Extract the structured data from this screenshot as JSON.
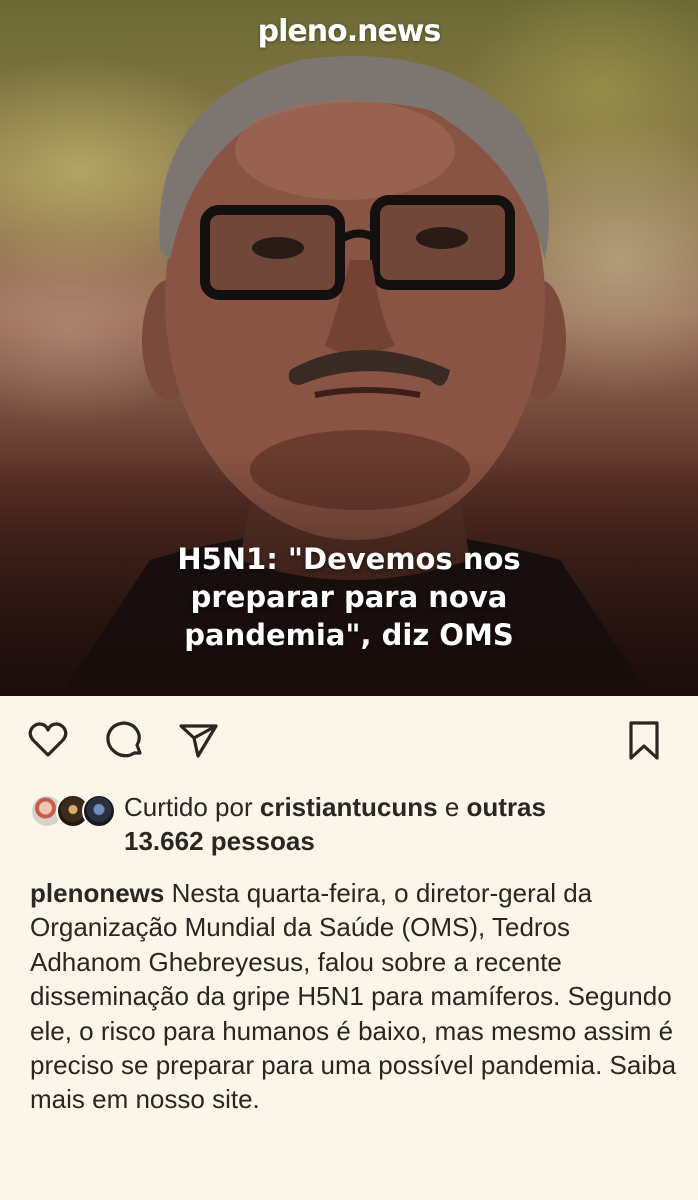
{
  "post": {
    "brand": "pleno.news",
    "headline_lines": [
      "H5N1: \"Devemos nos",
      "preparar para nova",
      "pandemia\", diz OMS"
    ]
  },
  "actions": {
    "icons": [
      "heart-icon",
      "comment-icon",
      "share-icon",
      "bookmark-icon"
    ]
  },
  "likes": {
    "prefix": "Curtido por",
    "user": "cristiantucuns",
    "conjunction": "e",
    "others": "outras",
    "count": "13.662 pessoas"
  },
  "caption": {
    "username": "plenonews",
    "text": "Nesta quarta-feira, o diretor-geral da Organização Mundial da Saúde (OMS), Tedros Adhanom Ghebreyesus, falou sobre a recente disseminação da gripe H5N1 para mamíferos. Segundo ele, o risco para humanos é baixo, mas mesmo assim é preciso se preparar para uma possível pandemia. Saiba mais em nosso site."
  },
  "colors": {
    "background": "#fbf5ea",
    "text": "#2a2622",
    "headline": "#ffffff"
  }
}
